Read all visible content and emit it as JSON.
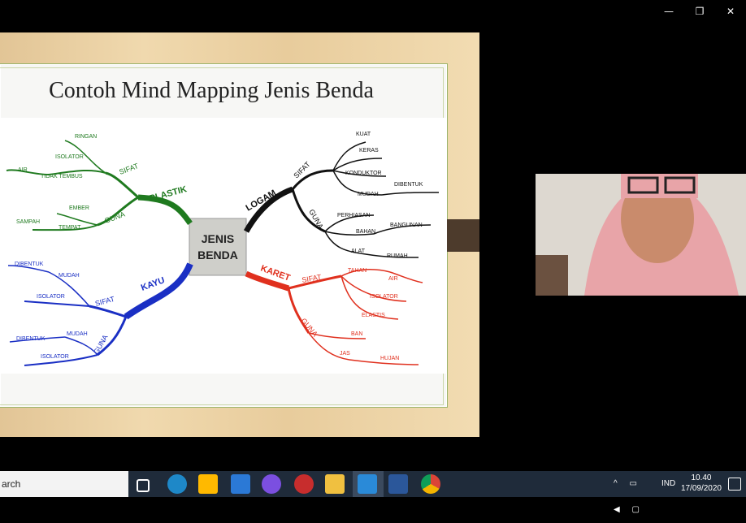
{
  "window_controls": {
    "minimize": "—",
    "restore": "❐",
    "close": "✕"
  },
  "slide": {
    "title": "Contoh Mind Mapping Jenis Benda",
    "center": [
      "JENIS",
      "BENDA"
    ],
    "branches": {
      "plastik": {
        "label": "PLASTIK",
        "sifat": "SIFAT",
        "guna": "GUNA",
        "sifat_items": [
          "RINGAN",
          "ISOLATOR",
          "AIR",
          "TIDAK TEMBUS"
        ],
        "guna_items": [
          "EMBER",
          "TEMPAT",
          "SAMPAH"
        ]
      },
      "kayu": {
        "label": "KAYU",
        "sifat": "SIFAT",
        "guna": "GUNA",
        "sifat_items": [
          "DIBENTUK",
          "MUDAH",
          "ISOLATOR"
        ],
        "guna_items": [
          "DIBENTUK",
          "MUDAH",
          "ISOLATOR"
        ]
      },
      "logam": {
        "label": "LOGAM",
        "sifat": "SIFAT",
        "guna": "GUNA",
        "sifat_items": [
          "KUAT",
          "KERAS",
          "KONDUKTOR",
          "MUDAH",
          "DIBENTUK"
        ],
        "guna_items": [
          "PERHIASAN",
          "BAHAN",
          "BANGUNAN",
          "ALAT",
          "RUMAH"
        ]
      },
      "karet": {
        "label": "KARET",
        "sifat": "SIFAT",
        "guna": "GUNA",
        "sifat_items": [
          "TAHAN",
          "AIR",
          "ISOLATOR",
          "ELASTIS"
        ],
        "guna_items": [
          "BAN",
          "JAS",
          "HUJAN"
        ]
      }
    },
    "colors": {
      "plastik": "#1f7a1f",
      "kayu": "#1a2fc4",
      "logam": "#111111",
      "karet": "#e0301e"
    }
  },
  "taskbar": {
    "search_text": "arch",
    "icons": [
      "task-view-icon",
      "edge-icon",
      "store-icon",
      "mail-icon",
      "app-icon",
      "settings-app-icon",
      "file-explorer-icon",
      "video-app-icon",
      "word-icon",
      "chrome-icon"
    ],
    "tray": {
      "lang": "IND",
      "time": "10.40",
      "date": "17/09/2020"
    }
  }
}
